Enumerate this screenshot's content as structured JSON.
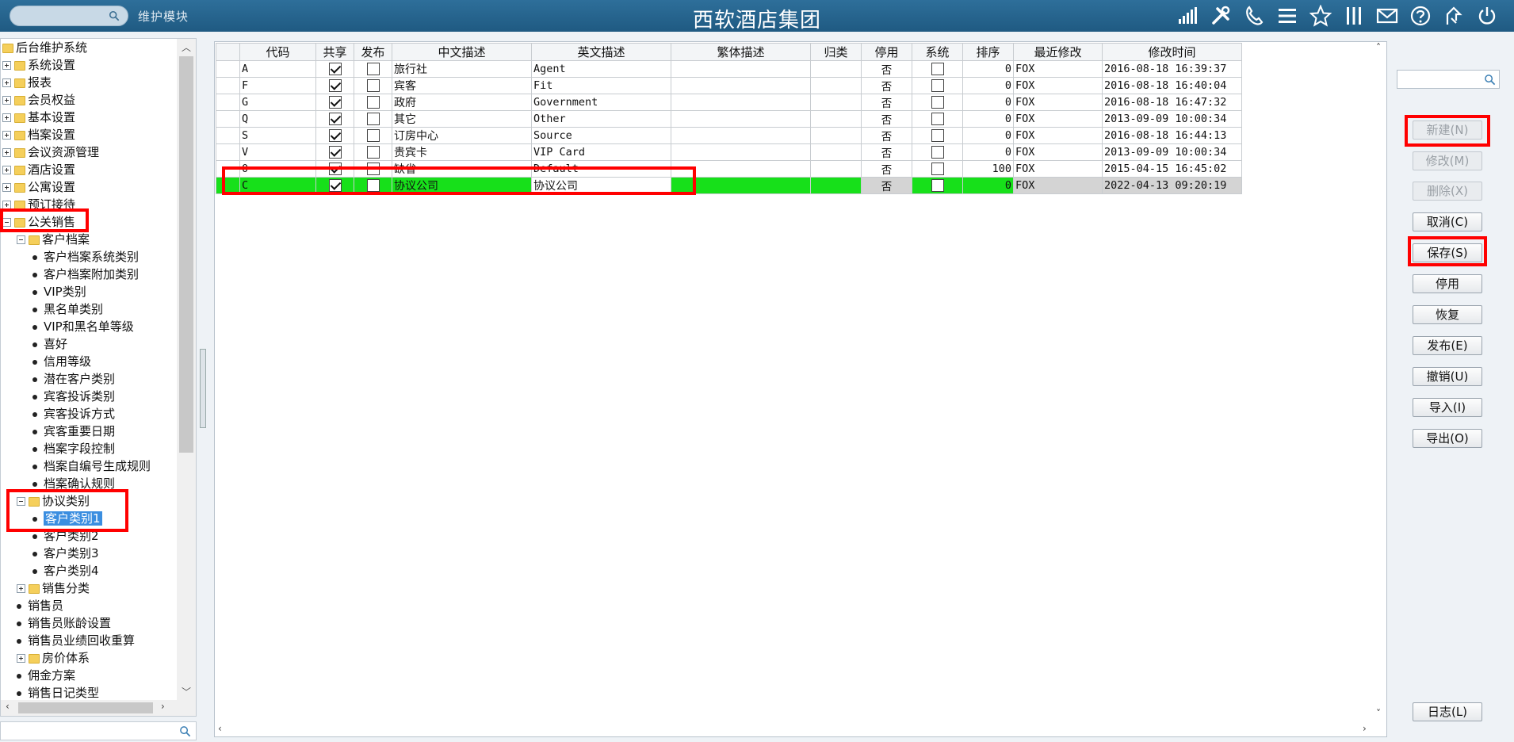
{
  "header": {
    "search_placeholder": "",
    "module_label": "维护模块",
    "title": "西软酒店集团",
    "icons": [
      "signal-icon",
      "tools-icon",
      "phone-icon",
      "menu-icon",
      "star-icon",
      "columns-icon",
      "mail-icon",
      "help-icon",
      "sign-out-icon",
      "power-icon"
    ]
  },
  "tree": {
    "nodes": [
      {
        "label": "后台维护系统",
        "level": 0,
        "kind": "folder",
        "exp": "none"
      },
      {
        "label": "系统设置",
        "level": 0,
        "kind": "folder",
        "exp": "plus"
      },
      {
        "label": "报表",
        "level": 0,
        "kind": "folder",
        "exp": "plus"
      },
      {
        "label": "会员权益",
        "level": 0,
        "kind": "folder",
        "exp": "plus"
      },
      {
        "label": "基本设置",
        "level": 0,
        "kind": "folder",
        "exp": "plus"
      },
      {
        "label": "档案设置",
        "level": 0,
        "kind": "folder",
        "exp": "plus"
      },
      {
        "label": "会议资源管理",
        "level": 0,
        "kind": "folder",
        "exp": "plus"
      },
      {
        "label": "酒店设置",
        "level": 0,
        "kind": "folder",
        "exp": "plus"
      },
      {
        "label": "公寓设置",
        "level": 0,
        "kind": "folder",
        "exp": "plus"
      },
      {
        "label": "预订接待",
        "level": 0,
        "kind": "folder",
        "exp": "plus"
      },
      {
        "label": "公关销售",
        "level": 0,
        "kind": "folder",
        "exp": "minus"
      },
      {
        "label": "客户档案",
        "level": 1,
        "kind": "folder",
        "exp": "minus"
      },
      {
        "label": "客户档案系统类别",
        "level": 2,
        "kind": "leaf"
      },
      {
        "label": "客户档案附加类别",
        "level": 2,
        "kind": "leaf"
      },
      {
        "label": "VIP类别",
        "level": 2,
        "kind": "leaf"
      },
      {
        "label": "黑名单类别",
        "level": 2,
        "kind": "leaf"
      },
      {
        "label": "VIP和黑名单等级",
        "level": 2,
        "kind": "leaf"
      },
      {
        "label": "喜好",
        "level": 2,
        "kind": "leaf"
      },
      {
        "label": "信用等级",
        "level": 2,
        "kind": "leaf"
      },
      {
        "label": "潜在客户类别",
        "level": 2,
        "kind": "leaf"
      },
      {
        "label": "宾客投诉类别",
        "level": 2,
        "kind": "leaf"
      },
      {
        "label": "宾客投诉方式",
        "level": 2,
        "kind": "leaf"
      },
      {
        "label": "宾客重要日期",
        "level": 2,
        "kind": "leaf"
      },
      {
        "label": "档案字段控制",
        "level": 2,
        "kind": "leaf"
      },
      {
        "label": "档案自编号生成规则",
        "level": 2,
        "kind": "leaf"
      },
      {
        "label": "档案确认规则",
        "level": 2,
        "kind": "leaf"
      },
      {
        "label": "协议类别",
        "level": 1,
        "kind": "folder",
        "exp": "minus"
      },
      {
        "label": "客户类别1",
        "level": 2,
        "kind": "leaf",
        "selected": true
      },
      {
        "label": "客户类别2",
        "level": 2,
        "kind": "leaf"
      },
      {
        "label": "客户类别3",
        "level": 2,
        "kind": "leaf"
      },
      {
        "label": "客户类别4",
        "level": 2,
        "kind": "leaf"
      },
      {
        "label": "销售分类",
        "level": 1,
        "kind": "folder",
        "exp": "plus"
      },
      {
        "label": "销售员",
        "level": 1,
        "kind": "leaf"
      },
      {
        "label": "销售员账龄设置",
        "level": 1,
        "kind": "leaf"
      },
      {
        "label": "销售员业绩回收重算",
        "level": 1,
        "kind": "leaf"
      },
      {
        "label": "房价体系",
        "level": 1,
        "kind": "folder",
        "exp": "plus"
      },
      {
        "label": "佣金方案",
        "level": 1,
        "kind": "leaf"
      },
      {
        "label": "销售日记类型",
        "level": 1,
        "kind": "leaf"
      }
    ]
  },
  "grid": {
    "columns": [
      "代码",
      "共享",
      "发布",
      "中文描述",
      "英文描述",
      "繁体描述",
      "归类",
      "停用",
      "系统",
      "排序",
      "最近修改",
      "修改时间"
    ],
    "rows": [
      {
        "code": "A",
        "share": true,
        "publish": false,
        "zh": "旅行社",
        "en": "Agent",
        "tw": "",
        "cat": "",
        "halt": "否",
        "sys": false,
        "sort": "0",
        "by": "FOX",
        "time": "2016-08-18 16:39:37"
      },
      {
        "code": "F",
        "share": true,
        "publish": false,
        "zh": "宾客",
        "en": "Fit",
        "tw": "",
        "cat": "",
        "halt": "否",
        "sys": false,
        "sort": "0",
        "by": "FOX",
        "time": "2016-08-18 16:40:04"
      },
      {
        "code": "G",
        "share": true,
        "publish": false,
        "zh": "政府",
        "en": "Government",
        "tw": "",
        "cat": "",
        "halt": "否",
        "sys": false,
        "sort": "0",
        "by": "FOX",
        "time": "2016-08-18 16:47:32"
      },
      {
        "code": "Q",
        "share": true,
        "publish": false,
        "zh": "其它",
        "en": "Other",
        "tw": "",
        "cat": "",
        "halt": "否",
        "sys": false,
        "sort": "0",
        "by": "FOX",
        "time": "2013-09-09 10:00:34"
      },
      {
        "code": "S",
        "share": true,
        "publish": false,
        "zh": "订房中心",
        "en": "Source",
        "tw": "",
        "cat": "",
        "halt": "否",
        "sys": false,
        "sort": "0",
        "by": "FOX",
        "time": "2016-08-18 16:44:13"
      },
      {
        "code": "V",
        "share": true,
        "publish": false,
        "zh": "贵宾卡",
        "en": "VIP Card",
        "tw": "",
        "cat": "",
        "halt": "否",
        "sys": false,
        "sort": "0",
        "by": "FOX",
        "time": "2013-09-09 10:00:34"
      },
      {
        "code": "0",
        "share": true,
        "publish": false,
        "zh": "缺省",
        "en": "Default",
        "tw": "",
        "cat": "",
        "halt": "否",
        "sys": false,
        "sort": "100",
        "by": "FOX",
        "time": "2015-04-15 16:45:02"
      },
      {
        "code": "C",
        "share": true,
        "publish": false,
        "zh": "协议公司",
        "en": "协议公司",
        "tw": "",
        "cat": "",
        "halt": "否",
        "sys": false,
        "sort": "0",
        "by": "FOX",
        "time": "2022-04-13 09:20:19",
        "active": true
      }
    ]
  },
  "actions": {
    "search_placeholder": "",
    "buttons": [
      {
        "id": "new",
        "label": "新建(N)",
        "disabled": true
      },
      {
        "id": "modify",
        "label": "修改(M)",
        "disabled": true
      },
      {
        "id": "delete",
        "label": "删除(X)",
        "disabled": true
      },
      {
        "id": "cancel",
        "label": "取消(C)",
        "disabled": false
      },
      {
        "id": "save",
        "label": "保存(S)",
        "disabled": false
      },
      {
        "id": "halt",
        "label": "停用",
        "disabled": false
      },
      {
        "id": "restore",
        "label": "恢复",
        "disabled": false
      },
      {
        "id": "publish",
        "label": "发布(E)",
        "disabled": false
      },
      {
        "id": "revoke",
        "label": "撤销(U)",
        "disabled": false
      },
      {
        "id": "import",
        "label": "导入(I)",
        "disabled": false
      },
      {
        "id": "export",
        "label": "导出(O)",
        "disabled": false
      },
      {
        "id": "log",
        "label": "日志(L)",
        "disabled": false
      }
    ]
  },
  "colors": {
    "header_bg": "#2e6f9a",
    "active_row": "#17e01a",
    "highlight": "#ff0000",
    "selection": "#3b8ee0"
  }
}
